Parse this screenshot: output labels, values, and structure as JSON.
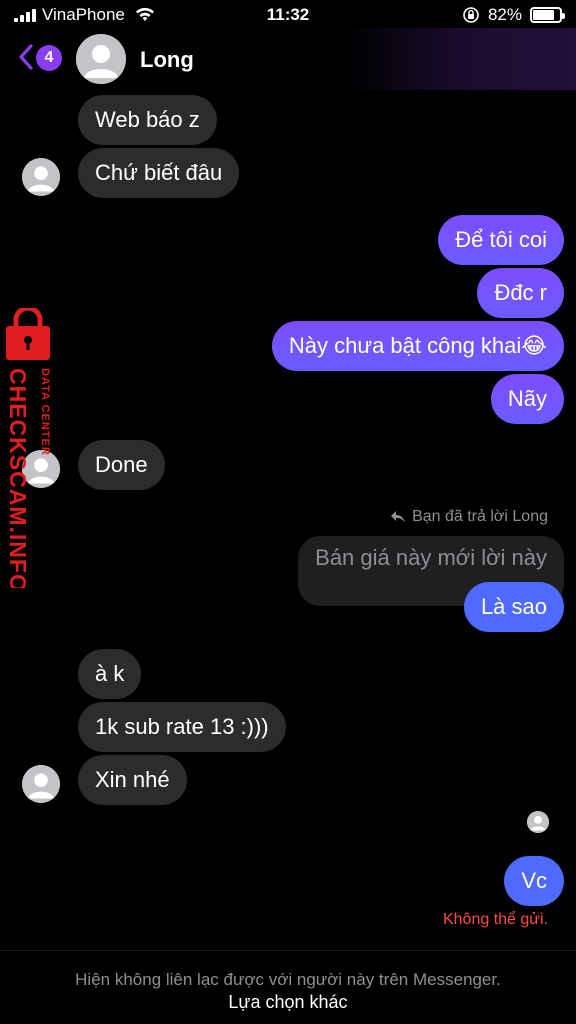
{
  "status_bar": {
    "carrier": "VinaPhone",
    "time": "11:32",
    "battery": "82%",
    "battery_level": 0.82
  },
  "header": {
    "unread_count": "4",
    "contact_name": "Long"
  },
  "messages": {
    "m1": "Web báo z",
    "m2": "Chứ biết đâu",
    "m3": "Để tôi coi",
    "m4": "Đđc r",
    "m5": "Này chưa bật công khai😂",
    "m6": "Nãy",
    "m7": "Done",
    "reply_note": "Bạn đã trả lời Long",
    "quoted": "Bán giá này mới lời này",
    "m8": "Là sao",
    "m9": "à k",
    "m10": "1k sub rate 13 :)))",
    "m11": "Xin nhé",
    "m12": "Vc",
    "send_error": "Không thể gửi."
  },
  "footer": {
    "note": "Hiện không liên lạc được với người này trên Messenger.",
    "action": "Lựa chọn khác"
  },
  "watermark": {
    "brand": "CHECKSCAM.INFO",
    "sub": "DATA CENTER"
  },
  "colors": {
    "outgoing": "#7c4dff",
    "incoming": "#2c2c2e",
    "error": "#ff4b43",
    "badge": "#8a3cf0"
  }
}
